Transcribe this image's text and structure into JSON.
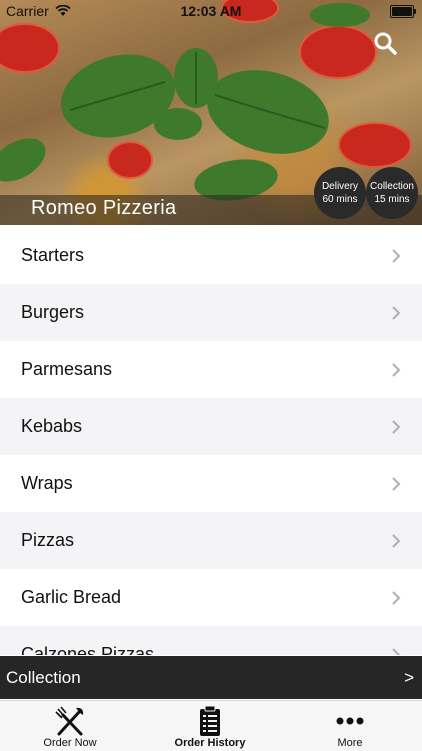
{
  "status_bar": {
    "carrier": "Carrier",
    "time": "12:03 AM"
  },
  "header": {
    "restaurant_name": "Romeo Pizzeria",
    "delivery": {
      "label": "Delivery",
      "time": "60 mins"
    },
    "collection": {
      "label": "Collection",
      "time": "15 mins"
    },
    "search_icon": "search-icon"
  },
  "categories": [
    {
      "label": "Starters"
    },
    {
      "label": "Burgers"
    },
    {
      "label": "Parmesans"
    },
    {
      "label": "Kebabs"
    },
    {
      "label": "Wraps"
    },
    {
      "label": "Pizzas"
    },
    {
      "label": "Garlic Bread"
    },
    {
      "label": "Calzones Pizzas"
    }
  ],
  "order_bar": {
    "label": "Collection",
    "arrow": ">"
  },
  "tabs": [
    {
      "label": "Order Now",
      "icon": "fork-knife-icon"
    },
    {
      "label": "Order History",
      "icon": "clipboard-icon"
    },
    {
      "label": "More",
      "icon": "more-dots-icon"
    }
  ],
  "colors": {
    "dark_bar": "#262626",
    "alt_row": "#f4f4f6",
    "tab_bar": "#f6f6f7"
  }
}
